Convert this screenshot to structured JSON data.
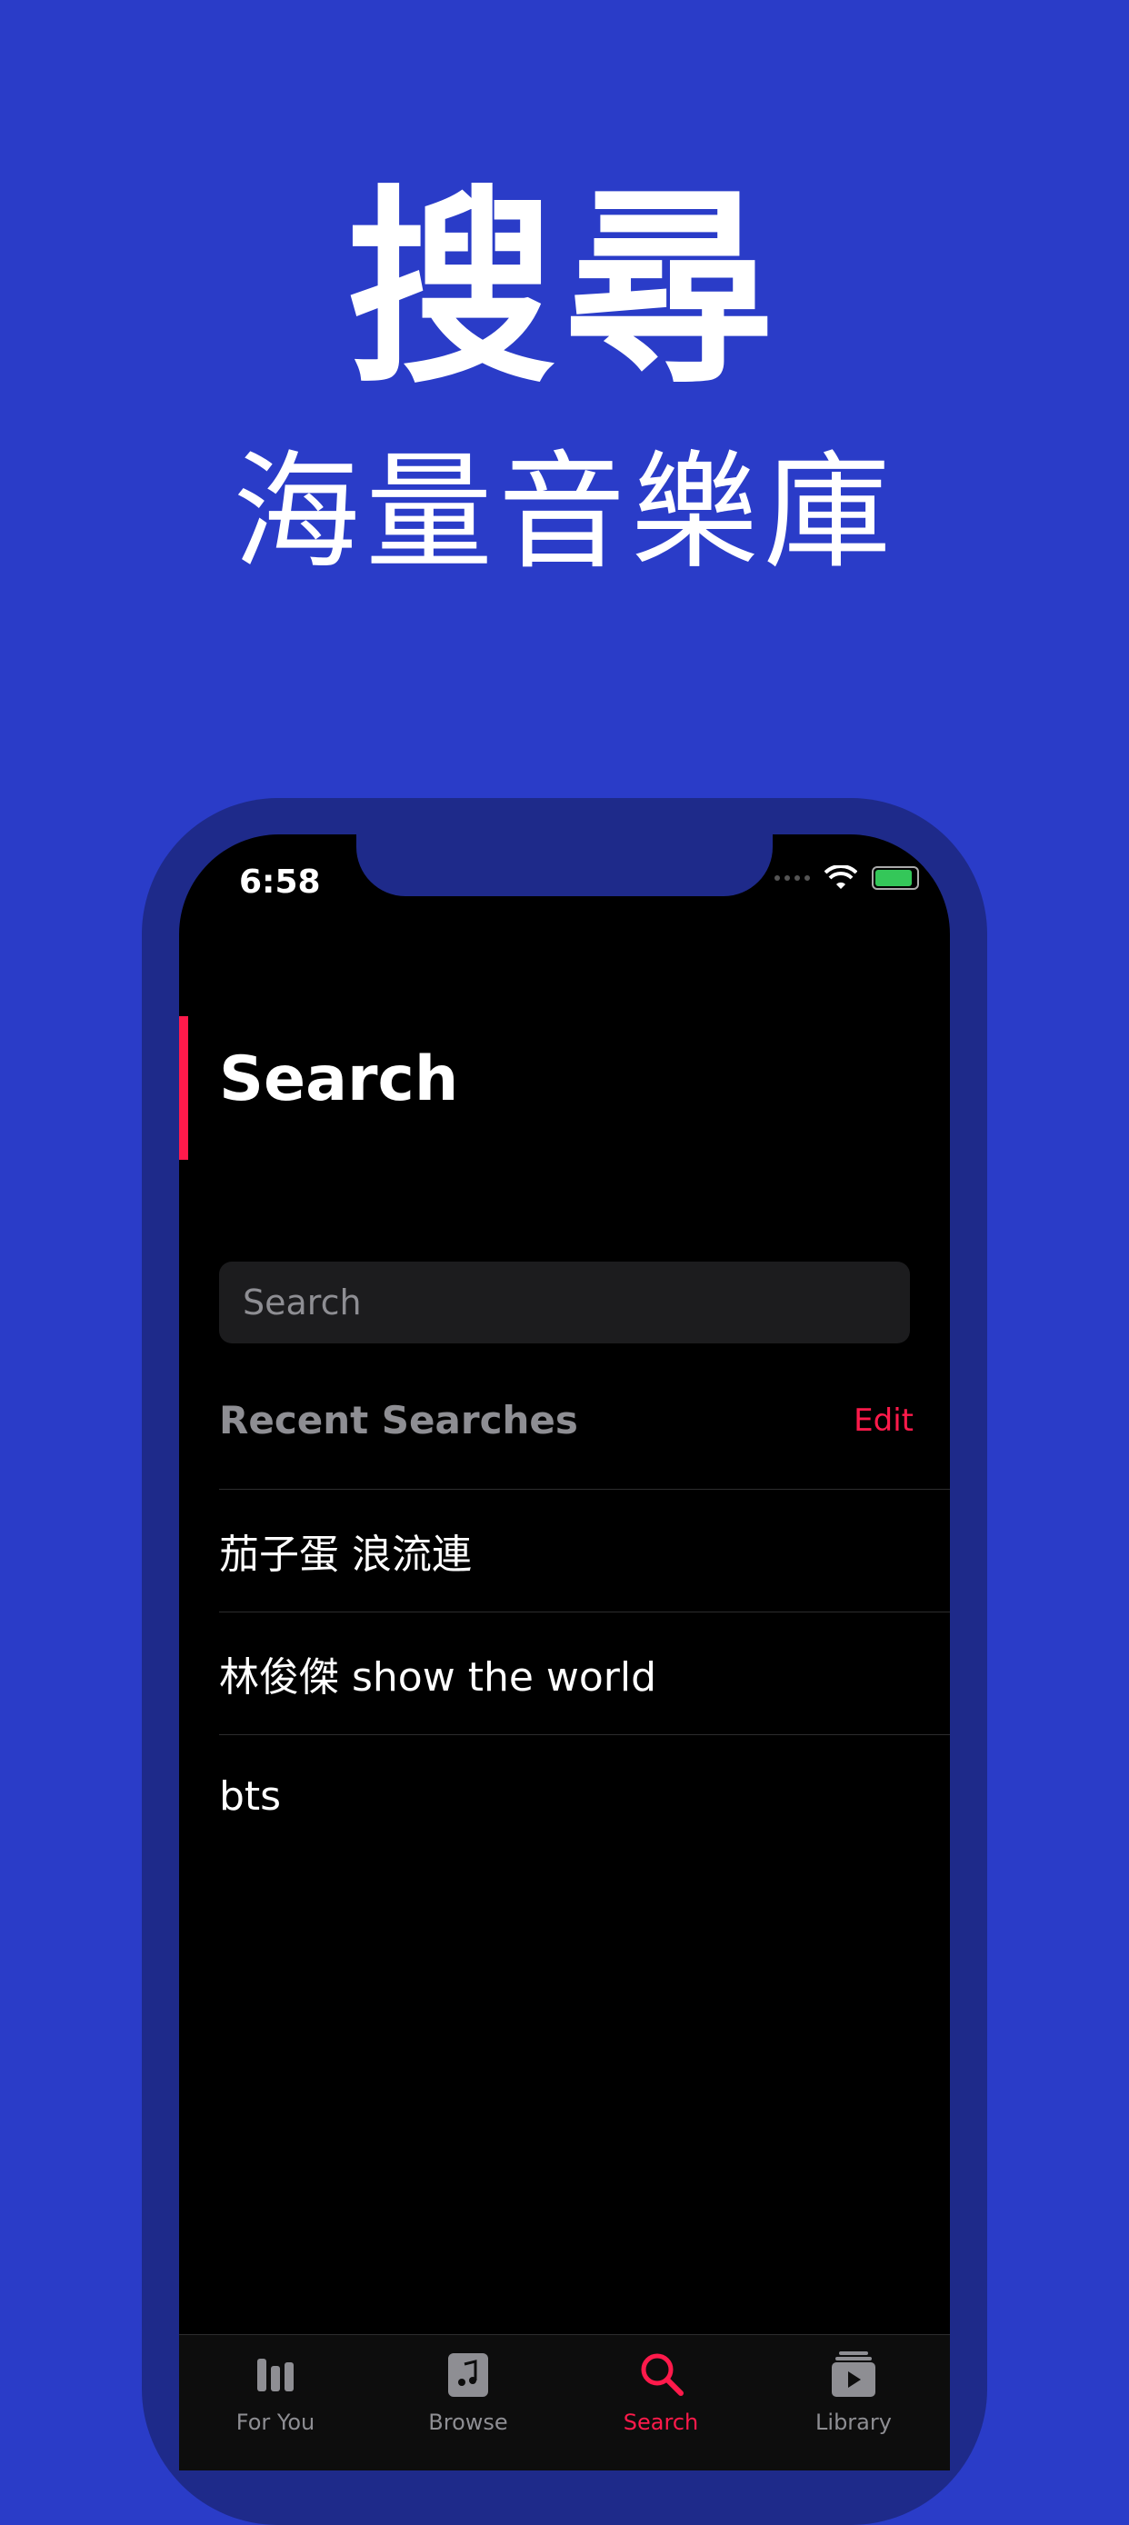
{
  "promo": {
    "title": "搜尋",
    "subtitle": "海量音樂庫"
  },
  "status_bar": {
    "time": "6:58"
  },
  "page": {
    "title": "Search"
  },
  "search": {
    "placeholder": "Search",
    "value": ""
  },
  "recent": {
    "title": "Recent Searches",
    "edit_label": "Edit",
    "items": [
      "茄子蛋 浪流連",
      "林俊傑 show the world",
      "bts"
    ]
  },
  "tab_bar": {
    "tabs": [
      {
        "label": "For You",
        "icon": "for-you-icon",
        "active": false
      },
      {
        "label": "Browse",
        "icon": "browse-icon",
        "active": false
      },
      {
        "label": "Search",
        "icon": "search-icon",
        "active": true
      },
      {
        "label": "Library",
        "icon": "library-icon",
        "active": false
      }
    ]
  },
  "colors": {
    "background": "#2a3cc8",
    "accent": "#ff1a4b",
    "frame": "#1e2a8a"
  }
}
